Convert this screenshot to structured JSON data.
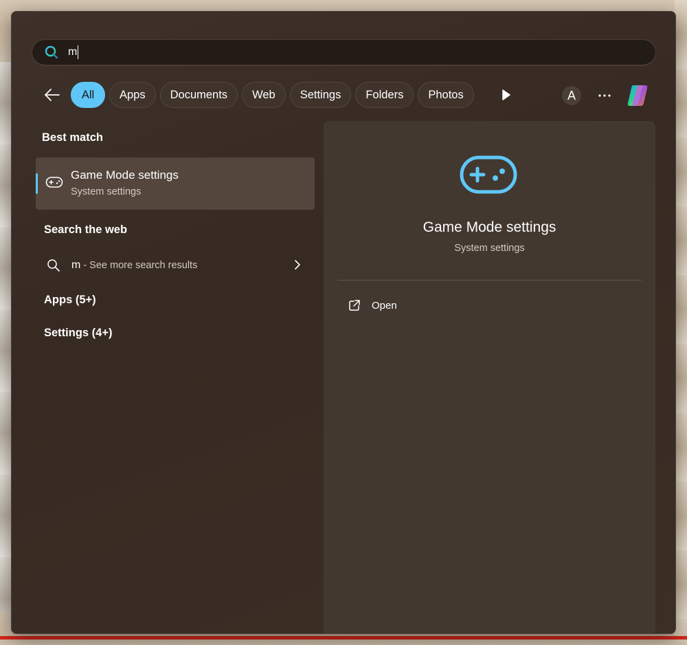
{
  "search": {
    "query": "m"
  },
  "filters": {
    "back_label": "Back",
    "chips": [
      "All",
      "Apps",
      "Documents",
      "Web",
      "Settings",
      "Folders",
      "Photos"
    ],
    "active": "All",
    "avatar_letter": "A"
  },
  "left": {
    "best_match_title": "Best match",
    "best_match": {
      "title": "Game Mode settings",
      "subtitle": "System settings",
      "icon": "gamepad-icon"
    },
    "search_web_title": "Search the web",
    "web_result": {
      "query": "m",
      "more_text": " - See more search results"
    },
    "apps_title": "Apps (5+)",
    "settings_title": "Settings (4+)"
  },
  "preview": {
    "title": "Game Mode settings",
    "subtitle": "System settings",
    "open_label": "Open",
    "icon": "gamepad-icon"
  },
  "colors": {
    "accent": "#5ec7f7",
    "panel": "#362a22",
    "preview_bg": "#433830"
  }
}
